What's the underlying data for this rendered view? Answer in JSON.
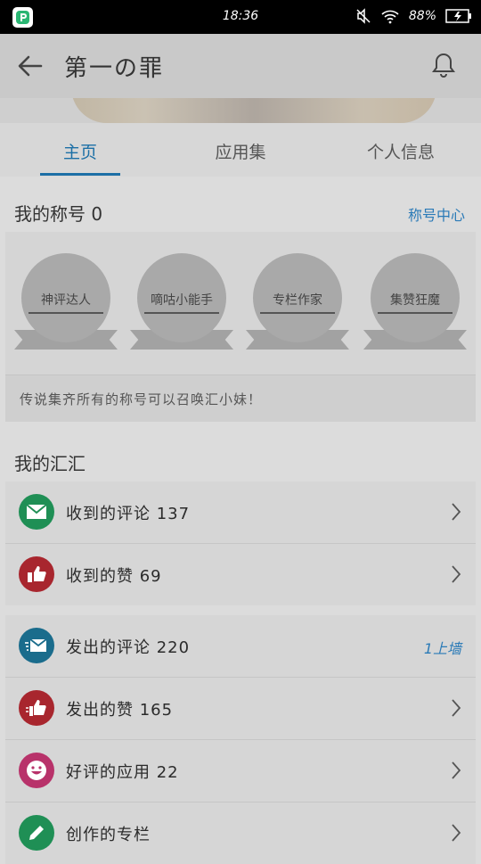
{
  "status_bar": {
    "time": "18:36",
    "battery": "88%"
  },
  "header": {
    "title": "第一の罪"
  },
  "tabs": [
    {
      "label": "主页",
      "active": true
    },
    {
      "label": "应用集",
      "active": false
    },
    {
      "label": "个人信息",
      "active": false
    }
  ],
  "badges_section": {
    "title": "我的称号 0",
    "center_link": "称号中心",
    "badges": [
      "神评达人",
      "嘀咕小能手",
      "专栏作家",
      "集赞狂魔"
    ],
    "hint": "传说集齐所有的称号可以召唤汇小妹！"
  },
  "my_section": {
    "title": "我的汇汇",
    "group1": [
      {
        "label": "收到的评论 137",
        "icon": "mail-icon",
        "color": "#1f8f55"
      },
      {
        "label": "收到的赞 69",
        "icon": "thumb-up-icon",
        "color": "#a8262e"
      }
    ],
    "group2": [
      {
        "label": "发出的评论 220",
        "icon": "send-mail-icon",
        "color": "#1a6c8c",
        "right": "1上墙"
      },
      {
        "label": "发出的赞 165",
        "icon": "send-thumb-icon",
        "color": "#a8262e"
      },
      {
        "label": "好评的应用 22",
        "icon": "smile-icon",
        "color": "#b8326a"
      },
      {
        "label": "创作的专栏",
        "icon": "pencil-icon",
        "color": "#1f8f55"
      }
    ]
  }
}
